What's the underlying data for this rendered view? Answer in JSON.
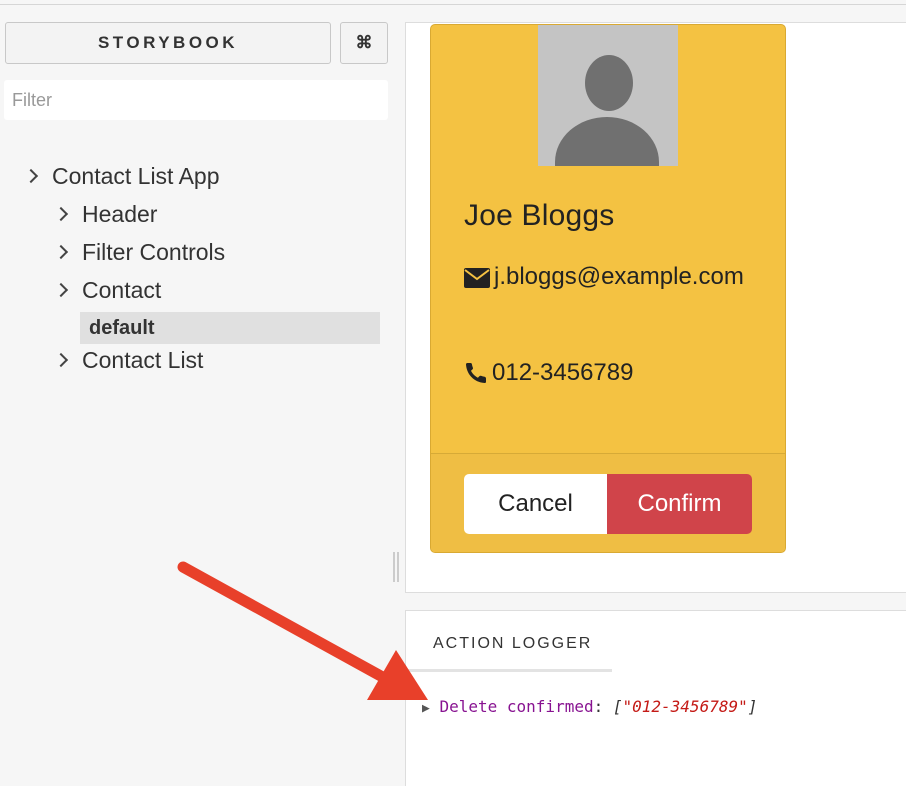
{
  "sidebar": {
    "title": "STORYBOOK",
    "shortcut_label": "⌘",
    "filter_placeholder": "Filter",
    "tree": [
      {
        "label": "Contact List App"
      },
      {
        "label": "Header"
      },
      {
        "label": "Filter Controls"
      },
      {
        "label": "Contact"
      },
      {
        "label": "default",
        "selected": true
      },
      {
        "label": "Contact List"
      }
    ]
  },
  "card": {
    "name": "Joe Bloggs",
    "email": "j.bloggs@example.com",
    "phone": "012-3456789",
    "cancel_label": "Cancel",
    "confirm_label": "Confirm"
  },
  "addons": {
    "tab_label": "ACTION LOGGER",
    "log": {
      "expander": "▶",
      "action": "Delete confirmed",
      "separator": ": ",
      "open_bracket": "[",
      "value": "\"012-3456789\"",
      "close_bracket": "]"
    }
  },
  "colors": {
    "card_bg": "#f4c242",
    "confirm_bg": "#d0444a",
    "arrow": "#e8402a"
  },
  "icons": [
    "command-icon",
    "chevron-right-icon",
    "avatar-placeholder-icon",
    "envelope-icon",
    "phone-icon",
    "arrow-annotation"
  ]
}
